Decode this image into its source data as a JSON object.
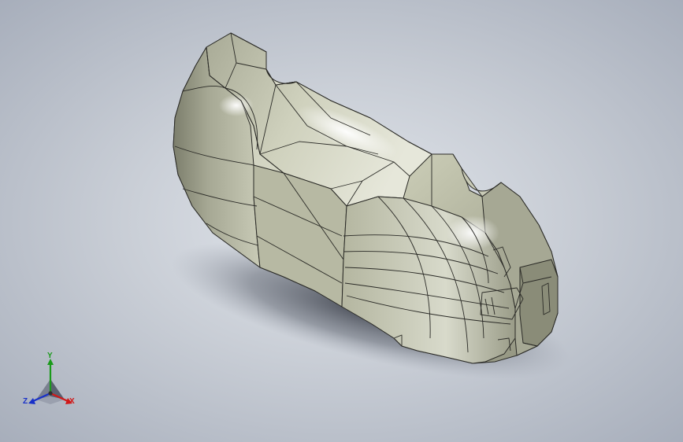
{
  "viewport": {
    "background_center": "#e2e6ec",
    "background_edge": "#a7aebb"
  },
  "model": {
    "shape": "hammer-head-like solid part, isometric shaded view",
    "face_color": "#c2c4ae",
    "highlight_color": "#f6f6f0",
    "shade_color": "#6e7060",
    "edge_color": "#2a2a26"
  },
  "triad": {
    "y_label": "Y",
    "x_label": "X",
    "z_label": "Z",
    "y_color": "#1a9a1a",
    "x_color": "#d01818",
    "z_color": "#1830c8"
  }
}
